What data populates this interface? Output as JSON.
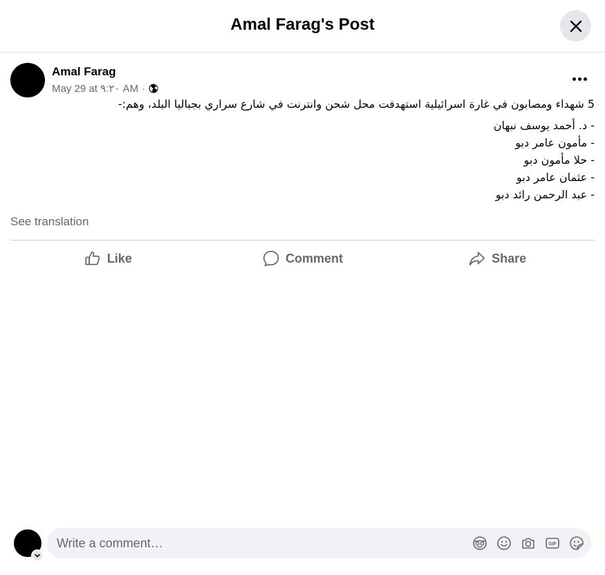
{
  "header": {
    "title": "Amal Farag's Post"
  },
  "post": {
    "author": "Amal Farag",
    "timestamp": "May 29 at ٩:٢٠ AM",
    "separator": "·",
    "privacy_icon": "globe-icon",
    "text_lines": [
      "5 شهداء ومصابون في غارة اسرائيلية استهدفت محل شحن وانترنت في شارع سراري بجباليا البلد، وهم:-",
      "- د. أحمد يوسف نبهان",
      "- مأمون عامر دبو",
      "- حلا مأمون دبو",
      "- عثمان عامر دبو",
      "- عبد الرحمن رائد دبو"
    ],
    "see_translation": "See translation"
  },
  "actions": {
    "like": "Like",
    "comment": "Comment",
    "share": "Share"
  },
  "composer": {
    "placeholder": "Write a comment…",
    "icons": [
      "avatar-sticker-icon",
      "emoji-icon",
      "camera-icon",
      "gif-icon",
      "sticker-icon"
    ]
  },
  "colors": {
    "primary_text": "#050505",
    "secondary_text": "#65676b",
    "divider": "#ced0d4",
    "button_bg": "#e4e6eb",
    "input_bg": "#f0f2f5"
  }
}
